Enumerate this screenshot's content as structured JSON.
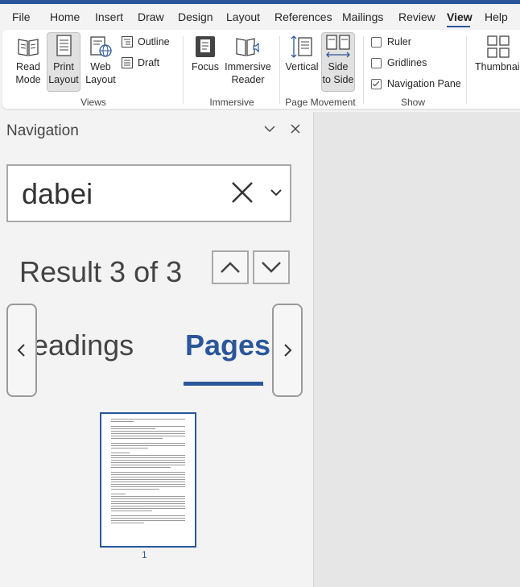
{
  "menu": {
    "items": [
      "File",
      "Home",
      "Insert",
      "Draw",
      "Design",
      "Layout",
      "References",
      "Mailings",
      "Review",
      "View",
      "Help"
    ],
    "active": "View"
  },
  "ribbon": {
    "views": {
      "read_mode": [
        "Read",
        "Mode"
      ],
      "print_layout": [
        "Print",
        "Layout"
      ],
      "web_layout": [
        "Web",
        "Layout"
      ],
      "outline": "Outline",
      "draft": "Draft",
      "group_label": "Views"
    },
    "immersive": {
      "focus": "Focus",
      "immersive_reader": [
        "Immersive",
        "Reader"
      ],
      "group_label": "Immersive"
    },
    "page_movement": {
      "vertical": "Vertical",
      "side_to_side": [
        "Side",
        "to Side"
      ],
      "group_label": "Page Movement"
    },
    "show": {
      "ruler": {
        "label": "Ruler",
        "checked": false
      },
      "gridlines": {
        "label": "Gridlines",
        "checked": false
      },
      "navigation_pane": {
        "label": "Navigation Pane",
        "checked": true
      },
      "group_label": "Show"
    },
    "thumbnails": "Thumbnail"
  },
  "navigation": {
    "title": "Navigation",
    "search": {
      "value": "dabei"
    },
    "result": "Result 3 of 3",
    "tabs": [
      {
        "label": "eadings",
        "active": false
      },
      {
        "label": "Pages",
        "active": true
      }
    ],
    "page_thumbnails": [
      {
        "number": "1"
      }
    ]
  },
  "colors": {
    "accent": "#2b579a",
    "ribbon_bg": "#f3f3f3",
    "document_bg": "#e6e6e6"
  }
}
